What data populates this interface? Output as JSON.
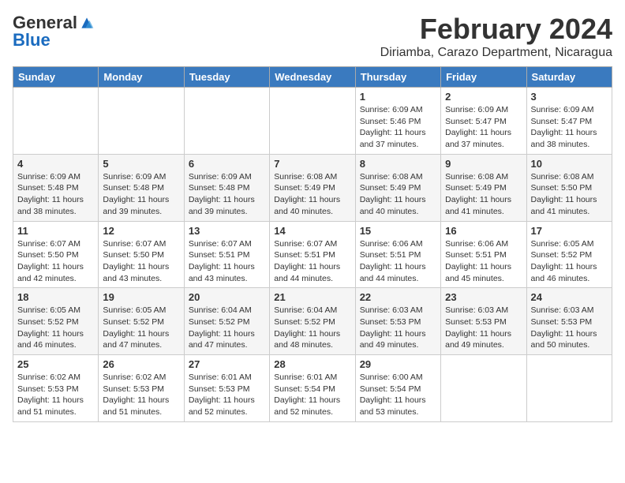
{
  "logo": {
    "general": "General",
    "blue": "Blue"
  },
  "title": "February 2024",
  "subtitle": "Diriamba, Carazo Department, Nicaragua",
  "weekdays": [
    "Sunday",
    "Monday",
    "Tuesday",
    "Wednesday",
    "Thursday",
    "Friday",
    "Saturday"
  ],
  "weeks": [
    [
      {
        "day": "",
        "info": ""
      },
      {
        "day": "",
        "info": ""
      },
      {
        "day": "",
        "info": ""
      },
      {
        "day": "",
        "info": ""
      },
      {
        "day": "1",
        "info": "Sunrise: 6:09 AM\nSunset: 5:46 PM\nDaylight: 11 hours and 37 minutes."
      },
      {
        "day": "2",
        "info": "Sunrise: 6:09 AM\nSunset: 5:47 PM\nDaylight: 11 hours and 37 minutes."
      },
      {
        "day": "3",
        "info": "Sunrise: 6:09 AM\nSunset: 5:47 PM\nDaylight: 11 hours and 38 minutes."
      }
    ],
    [
      {
        "day": "4",
        "info": "Sunrise: 6:09 AM\nSunset: 5:48 PM\nDaylight: 11 hours and 38 minutes."
      },
      {
        "day": "5",
        "info": "Sunrise: 6:09 AM\nSunset: 5:48 PM\nDaylight: 11 hours and 39 minutes."
      },
      {
        "day": "6",
        "info": "Sunrise: 6:09 AM\nSunset: 5:48 PM\nDaylight: 11 hours and 39 minutes."
      },
      {
        "day": "7",
        "info": "Sunrise: 6:08 AM\nSunset: 5:49 PM\nDaylight: 11 hours and 40 minutes."
      },
      {
        "day": "8",
        "info": "Sunrise: 6:08 AM\nSunset: 5:49 PM\nDaylight: 11 hours and 40 minutes."
      },
      {
        "day": "9",
        "info": "Sunrise: 6:08 AM\nSunset: 5:49 PM\nDaylight: 11 hours and 41 minutes."
      },
      {
        "day": "10",
        "info": "Sunrise: 6:08 AM\nSunset: 5:50 PM\nDaylight: 11 hours and 41 minutes."
      }
    ],
    [
      {
        "day": "11",
        "info": "Sunrise: 6:07 AM\nSunset: 5:50 PM\nDaylight: 11 hours and 42 minutes."
      },
      {
        "day": "12",
        "info": "Sunrise: 6:07 AM\nSunset: 5:50 PM\nDaylight: 11 hours and 43 minutes."
      },
      {
        "day": "13",
        "info": "Sunrise: 6:07 AM\nSunset: 5:51 PM\nDaylight: 11 hours and 43 minutes."
      },
      {
        "day": "14",
        "info": "Sunrise: 6:07 AM\nSunset: 5:51 PM\nDaylight: 11 hours and 44 minutes."
      },
      {
        "day": "15",
        "info": "Sunrise: 6:06 AM\nSunset: 5:51 PM\nDaylight: 11 hours and 44 minutes."
      },
      {
        "day": "16",
        "info": "Sunrise: 6:06 AM\nSunset: 5:51 PM\nDaylight: 11 hours and 45 minutes."
      },
      {
        "day": "17",
        "info": "Sunrise: 6:05 AM\nSunset: 5:52 PM\nDaylight: 11 hours and 46 minutes."
      }
    ],
    [
      {
        "day": "18",
        "info": "Sunrise: 6:05 AM\nSunset: 5:52 PM\nDaylight: 11 hours and 46 minutes."
      },
      {
        "day": "19",
        "info": "Sunrise: 6:05 AM\nSunset: 5:52 PM\nDaylight: 11 hours and 47 minutes."
      },
      {
        "day": "20",
        "info": "Sunrise: 6:04 AM\nSunset: 5:52 PM\nDaylight: 11 hours and 47 minutes."
      },
      {
        "day": "21",
        "info": "Sunrise: 6:04 AM\nSunset: 5:52 PM\nDaylight: 11 hours and 48 minutes."
      },
      {
        "day": "22",
        "info": "Sunrise: 6:03 AM\nSunset: 5:53 PM\nDaylight: 11 hours and 49 minutes."
      },
      {
        "day": "23",
        "info": "Sunrise: 6:03 AM\nSunset: 5:53 PM\nDaylight: 11 hours and 49 minutes."
      },
      {
        "day": "24",
        "info": "Sunrise: 6:03 AM\nSunset: 5:53 PM\nDaylight: 11 hours and 50 minutes."
      }
    ],
    [
      {
        "day": "25",
        "info": "Sunrise: 6:02 AM\nSunset: 5:53 PM\nDaylight: 11 hours and 51 minutes."
      },
      {
        "day": "26",
        "info": "Sunrise: 6:02 AM\nSunset: 5:53 PM\nDaylight: 11 hours and 51 minutes."
      },
      {
        "day": "27",
        "info": "Sunrise: 6:01 AM\nSunset: 5:53 PM\nDaylight: 11 hours and 52 minutes."
      },
      {
        "day": "28",
        "info": "Sunrise: 6:01 AM\nSunset: 5:54 PM\nDaylight: 11 hours and 52 minutes."
      },
      {
        "day": "29",
        "info": "Sunrise: 6:00 AM\nSunset: 5:54 PM\nDaylight: 11 hours and 53 minutes."
      },
      {
        "day": "",
        "info": ""
      },
      {
        "day": "",
        "info": ""
      }
    ]
  ]
}
